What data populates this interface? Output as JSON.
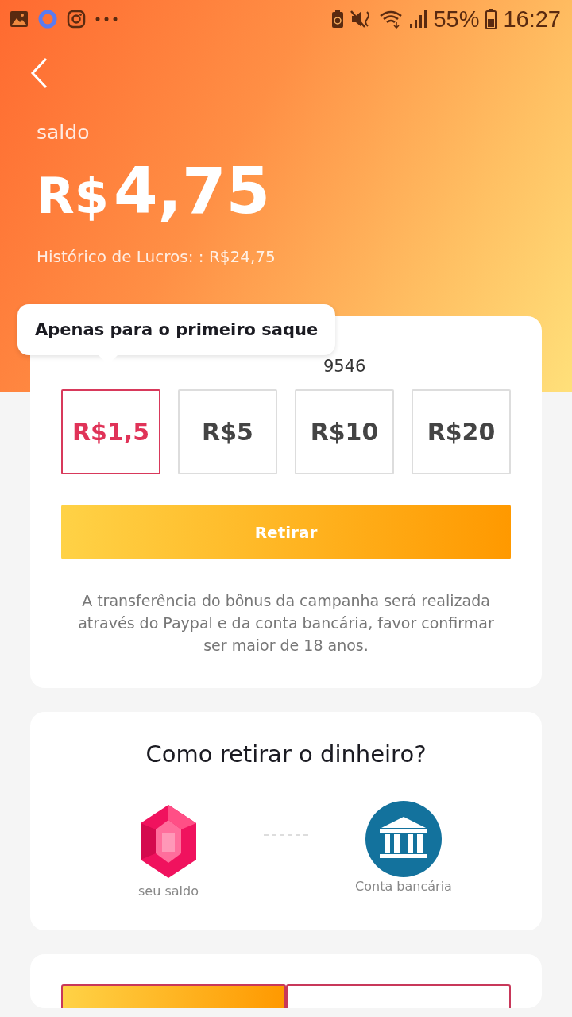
{
  "status_bar": {
    "battery": "55%",
    "time": "16:27"
  },
  "header": {
    "label": "saldo",
    "currency": "R$",
    "amount": "4,75",
    "history": "Histórico de Lucros: : R$24,75"
  },
  "withdraw_card": {
    "tooltip": "Apenas para o primeiro saque",
    "account_visible": "9546",
    "options": [
      {
        "label": "R$1,5",
        "selected": true
      },
      {
        "label": "R$5",
        "selected": false
      },
      {
        "label": "R$10",
        "selected": false
      },
      {
        "label": "R$20",
        "selected": false
      }
    ],
    "button": "Retirar",
    "note": "A transferência do bônus da campanha será realizada através do Paypal e da conta bancária, favor confirmar ser maior de 18 anos."
  },
  "how_card": {
    "title": "Como retirar o dinheiro?",
    "steps": [
      {
        "kind": "gem",
        "label": "seu saldo"
      },
      {
        "kind": "bank",
        "label": "Conta bancária"
      }
    ]
  },
  "bottom_tabs": [
    {
      "selected": true
    },
    {
      "selected": false
    }
  ]
}
